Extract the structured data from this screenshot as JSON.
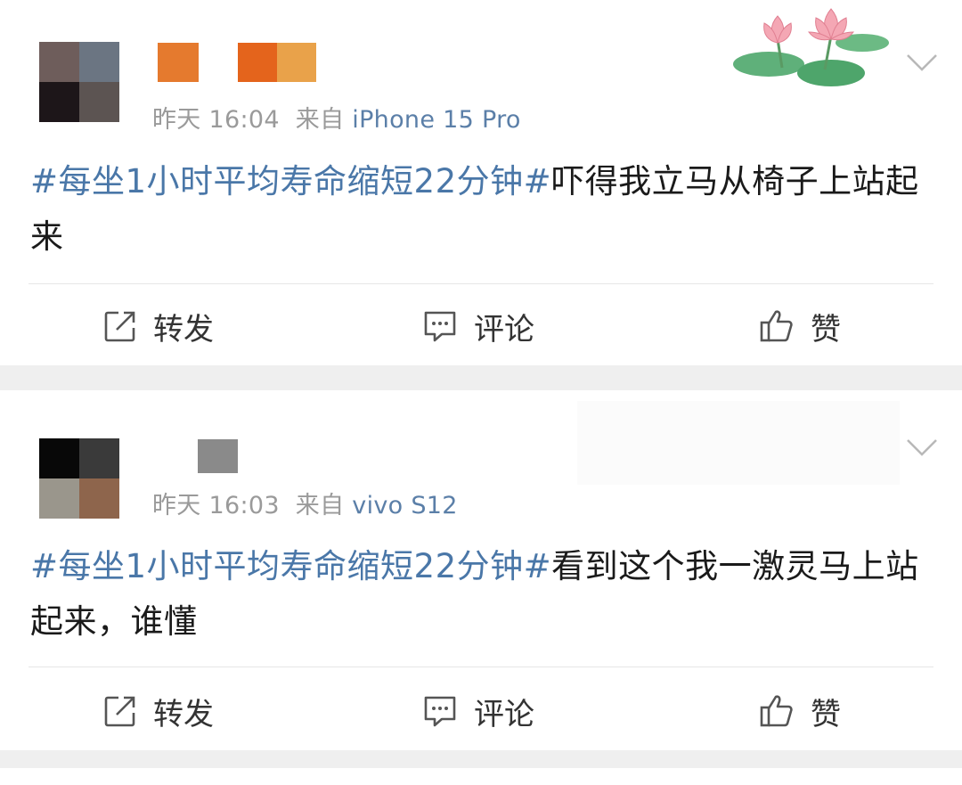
{
  "posts": [
    {
      "time": "昨天 16:04",
      "source_prefix": "来自",
      "source": "iPhone 15 Pro",
      "hashtag": "#每坐1小时平均寿命缩短22分钟#",
      "body": "吓得我立马从椅子上站起来",
      "avatar_colors": [
        "#6e5d5b",
        "#6b7582",
        "#1d1619",
        "#5c5452"
      ],
      "name_colors": [
        "#e57a2e",
        "#e4641c",
        "#e9a24a"
      ],
      "actions": {
        "repost": "转发",
        "comment": "评论",
        "like": "赞"
      }
    },
    {
      "time": "昨天 16:03",
      "source_prefix": "来自",
      "source": "vivo S12",
      "hashtag": "#每坐1小时平均寿命缩短22分钟#",
      "body": "看到这个我一激灵马上站起来，谁懂",
      "avatar_colors": [
        "#080808",
        "#3a3a3a",
        "#9a968c",
        "#8e654c"
      ],
      "name_colors": [
        "#8a8a8a"
      ],
      "actions": {
        "repost": "转发",
        "comment": "评论",
        "like": "赞"
      }
    }
  ],
  "icons": {
    "repost": "repost-icon",
    "comment": "comment-icon",
    "like": "thumbs-up-icon",
    "menu": "chevron-down-icon",
    "decoration": "lotus-sticker"
  },
  "colors": {
    "link": "#4a77a8",
    "meta": "#9a9a9a",
    "text": "#1a1a1a",
    "background": "#efefef"
  }
}
